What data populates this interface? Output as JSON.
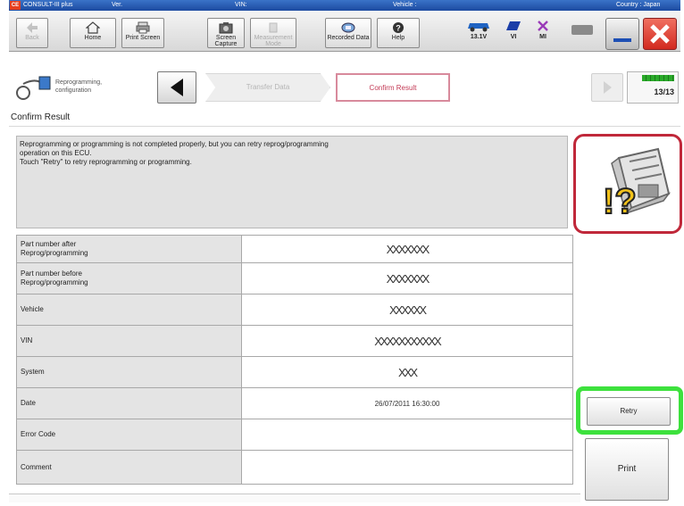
{
  "titlebar": {
    "logo": "CE",
    "app_name": "CONSULT-III plus",
    "ver_label": "Ver.",
    "vin_label": "VIN:",
    "vehicle_label": "Vehicle :",
    "country_label": "Country : Japan"
  },
  "toolbar": {
    "back": "Back",
    "home": "Home",
    "print_screen": "Print Screen",
    "screen_capture": "Screen Capture",
    "measurement_mode": "Measurement Mode",
    "recorded_data": "Recorded Data",
    "help": "Help",
    "voltage": "13.1V",
    "vi": "VI",
    "mi": "MI"
  },
  "nav": {
    "reprogramming_label": "Reprogramming, configuration",
    "prev_step": "Transfer Data",
    "current_step": "Confirm Result",
    "counter": "13/13"
  },
  "section_title": "Confirm Result",
  "message": "Reprogramming or programming is not completed properly, but you can retry reprog/programming\noperation on this ECU.\nTouch \"Retry\" to retry reprogramming or programming.",
  "ecu_icon": "ecu-warning-icon",
  "table": [
    {
      "label": "Part number after\nReprog/programming",
      "value": "XXXXXXX"
    },
    {
      "label": "Part number before\nReprog/programming",
      "value": "XXXXXXX"
    },
    {
      "label": "Vehicle",
      "value": "XXXXXX"
    },
    {
      "label": "VIN",
      "value": "XXXXXXXXXXX"
    },
    {
      "label": "System",
      "value": "XXX"
    },
    {
      "label": "Date",
      "value": "26/07/2011 16:30:00"
    },
    {
      "label": "Error Code",
      "value": ""
    },
    {
      "label": "Comment",
      "value": ""
    }
  ],
  "buttons": {
    "retry": "Retry",
    "print": "Print"
  },
  "colors": {
    "title_blue": "#2a5db8",
    "highlight_red": "#c0283a",
    "highlight_green": "#3de13d",
    "close_red": "#e33b32"
  }
}
